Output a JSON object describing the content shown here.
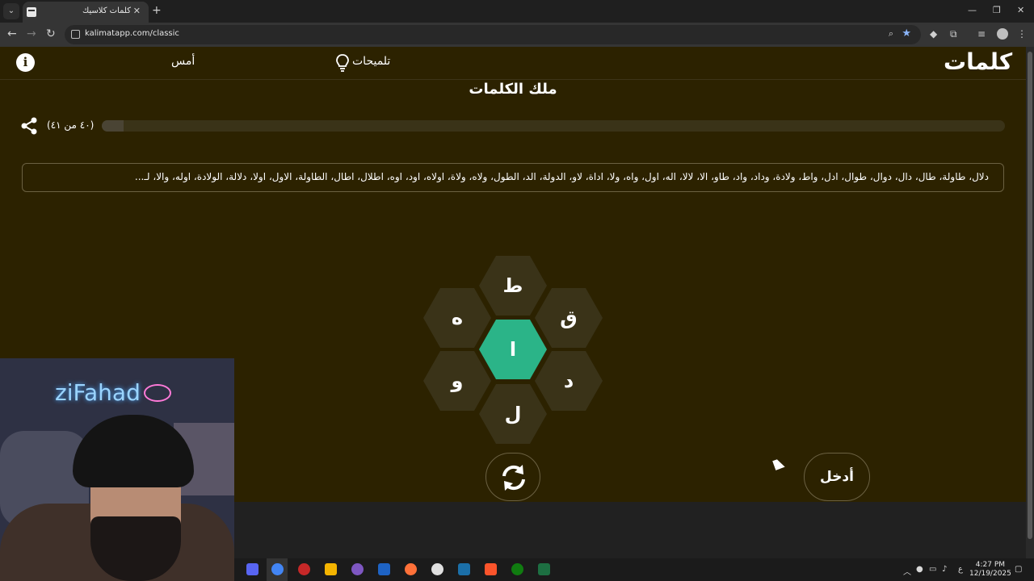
{
  "browser": {
    "tab_title": "كلمات كلاسيك",
    "url": "kalimatapp.com/classic",
    "new_tab": "+",
    "tab_close": "✕"
  },
  "header": {
    "logo": "كلمات",
    "hints_label": "تلميحات",
    "yesterday_label": "أمس",
    "info_label": "i"
  },
  "page_title": "ملك الكلمات",
  "progress": {
    "count_text": "(٤٠ من ٤١)",
    "fraction": 0.024
  },
  "found_words": "دلال، طاولة، طال، دال، دوال، طوال، ادل، واط، ولادة، وداد، واد، طاو، الا، لالا، اله، اول، واه، ولا، اداة، لاو، الدولة، الد، الطول، ولاه، ولاة، اولاه، اود، اوه، اطلال، اطال، الطاولة، الاول، اولا، دلالة، الولادة، اوله، والا، لـ...",
  "letters": {
    "top": "ط",
    "top_right": "ق",
    "bottom_right": "د",
    "bottom": "ل",
    "bottom_left": "و",
    "top_left": "ه",
    "center": "ا"
  },
  "buttons": {
    "enter": "أدخل"
  },
  "webcam": {
    "neon_text": "ziFahad"
  },
  "taskbar": {
    "time": "4:27 PM",
    "date": "12/19/2025",
    "lang": "ع"
  },
  "colors": {
    "page_bg": "#2c2200",
    "hex_bg": "#3a3318",
    "center_hex": "#2bb488",
    "text": "#ffffff"
  }
}
